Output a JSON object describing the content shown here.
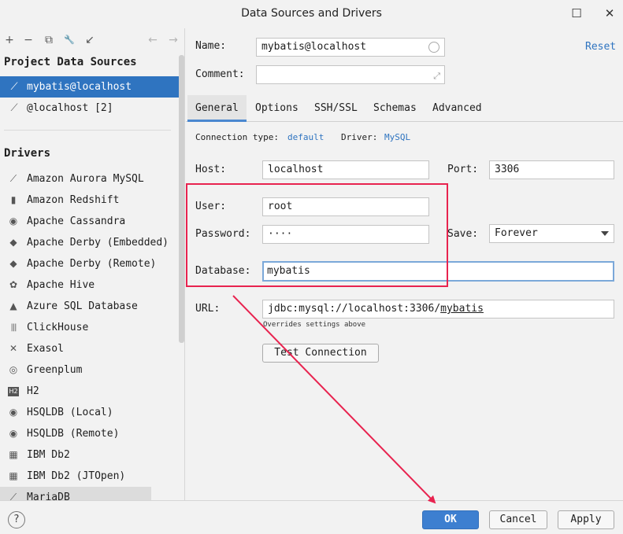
{
  "window": {
    "title": "Data Sources and Drivers",
    "minimize_icon": "☐",
    "close_icon": "✕"
  },
  "toolbar": {
    "add": "+",
    "remove": "−",
    "duplicate": "⧉",
    "properties": "🔧",
    "goto": "↙",
    "back": "←",
    "forward": "→"
  },
  "sidebar": {
    "project_title": "Project Data Sources",
    "data_sources": [
      {
        "label": "mybatis@localhost",
        "icon": "⟋",
        "selected": true
      },
      {
        "label": "@localhost [2]",
        "icon": "⟋",
        "selected": false
      }
    ],
    "drivers_title": "Drivers",
    "drivers": [
      {
        "label": "Amazon Aurora MySQL",
        "icon": "⟋"
      },
      {
        "label": "Amazon Redshift",
        "icon": "▮"
      },
      {
        "label": "Apache Cassandra",
        "icon": "◉"
      },
      {
        "label": "Apache Derby (Embedded)",
        "icon": "◆"
      },
      {
        "label": "Apache Derby (Remote)",
        "icon": "◆"
      },
      {
        "label": "Apache Hive",
        "icon": "✿"
      },
      {
        "label": "Azure SQL Database",
        "icon": "▲"
      },
      {
        "label": "ClickHouse",
        "icon": "|||"
      },
      {
        "label": "Exasol",
        "icon": "✕"
      },
      {
        "label": "Greenplum",
        "icon": "◎"
      },
      {
        "label": "H2",
        "icon": "H2"
      },
      {
        "label": "HSQLDB (Local)",
        "icon": "◉"
      },
      {
        "label": "HSQLDB (Remote)",
        "icon": "◉"
      },
      {
        "label": "IBM Db2",
        "icon": "▦"
      },
      {
        "label": "IBM Db2 (JTOpen)",
        "icon": "▦"
      },
      {
        "label": "MariaDB",
        "icon": "⟋"
      }
    ]
  },
  "form": {
    "name_label": "Name:",
    "name_value": "mybatis@localhost",
    "comment_label": "Comment:",
    "comment_value": "",
    "reset_label": "Reset",
    "tabs": [
      "General",
      "Options",
      "SSH/SSL",
      "Schemas",
      "Advanced"
    ],
    "conn_type_label": "Connection type:",
    "conn_type_value": "default",
    "driver_label": "Driver:",
    "driver_value": "MySQL",
    "host_label": "Host:",
    "host_value": "localhost",
    "port_label": "Port:",
    "port_value": "3306",
    "user_label": "User:",
    "user_value": "root",
    "password_label": "Password:",
    "password_value": "····",
    "save_label": "Save:",
    "save_value": "Forever",
    "database_label": "Database:",
    "database_value": "mybatis",
    "url_label": "URL:",
    "url_prefix": "jdbc:mysql://localhost:3306/",
    "url_db": "mybatis",
    "url_note": "Overrides settings above",
    "test_label": "Test Connection"
  },
  "footer": {
    "help": "?",
    "ok": "OK",
    "cancel": "Cancel",
    "apply": "Apply"
  },
  "colors": {
    "accent": "#2f74c0",
    "annotation": "#e8234f"
  }
}
